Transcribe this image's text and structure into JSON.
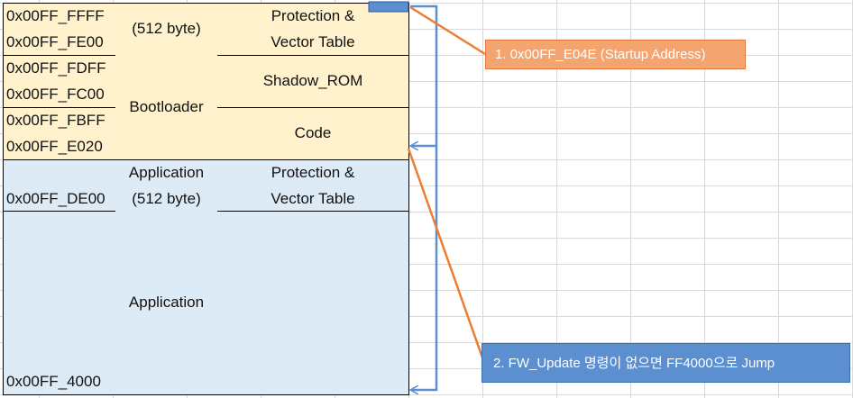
{
  "memory_map": {
    "addresses": [
      "0x00FF_FFFF",
      "0x00FF_FE00",
      "0x00FF_FDFF",
      "0x00FF_FC00",
      "0x00FF_FBFF",
      "0x00FF_E020",
      "0x00FF_DE00",
      "0x00FF_4000"
    ],
    "boot_size": "(512 byte)",
    "bootloader": "Bootloader",
    "protection_line1": "Protection &",
    "protection_line2": "Vector Table",
    "shadow_rom": "Shadow_ROM",
    "code": "Code",
    "app_header": "Application",
    "app_size": "(512 byte)",
    "app_protection_line1": "Protection &",
    "app_protection_line2": "Vector Table",
    "application": "Application"
  },
  "notes": {
    "startup": "1. 0x00FF_E04E (Startup Address)",
    "jump": "2. FW_Update 명령이 없으면 FF4000으로 Jump"
  },
  "colors": {
    "bootloader_fill": "#fff2cc",
    "application_fill": "#ddebf7",
    "arrow_blue": "#5b8fd0",
    "connector_orange": "#ed7d31",
    "note_orange": "#f4a46e"
  }
}
